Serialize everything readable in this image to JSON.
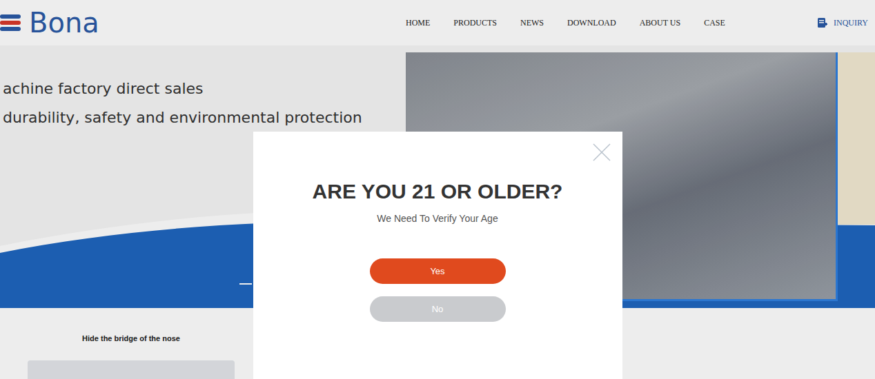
{
  "header": {
    "logo": "Bona",
    "nav": [
      {
        "label": "HOME"
      },
      {
        "label": "PRODUCTS"
      },
      {
        "label": "NEWS"
      },
      {
        "label": "DOWNLOAD"
      },
      {
        "label": "ABOUT US"
      },
      {
        "label": "CASE"
      }
    ],
    "inquiry": "INQUIRY"
  },
  "hero": {
    "lines": [
      "achine factory direct sales",
      "durability, safety and environmental protection"
    ]
  },
  "products": [
    {
      "caption": "Hide the bridge of the nose"
    }
  ],
  "modal": {
    "title": "ARE YOU 21 OR OLDER?",
    "subtitle": "We Need To Verify Your Age",
    "buttons": [
      {
        "label": "Yes",
        "primary": true
      },
      {
        "label": "No",
        "primary": false
      }
    ]
  }
}
